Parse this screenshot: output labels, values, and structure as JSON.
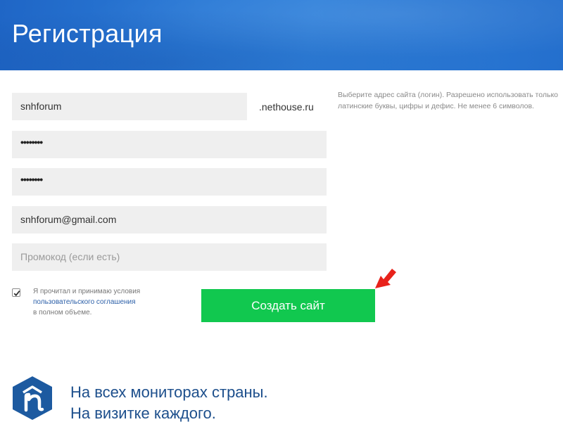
{
  "header": {
    "title": "Регистрация"
  },
  "form": {
    "login_value": "snhforum",
    "domain_suffix": ".nethouse.ru",
    "login_hint": "Выберите адрес сайта (логин). Разрешено использовать только латинские буквы, цифры и дефис. Не менее 6 символов.",
    "password_mask": "••••••••",
    "password_confirm_mask": "••••••••",
    "email_value": "snhforum@gmail.com",
    "promo_placeholder": "Промокод (если есть)",
    "agree_checked": true,
    "agree_text_1": "Я прочитал и принимаю условия",
    "agree_link": "пользовательского соглашения",
    "agree_text_2": "в полном объеме.",
    "submit_label": "Создать сайт"
  },
  "promo": {
    "line1": "На всех мониторах страны.",
    "line2": "На визитке каждого."
  },
  "colors": {
    "header_blue": "#2b7ad6",
    "button_green": "#11c84f",
    "slogan_blue": "#1d4f8c",
    "arrow_red": "#e8221b"
  }
}
